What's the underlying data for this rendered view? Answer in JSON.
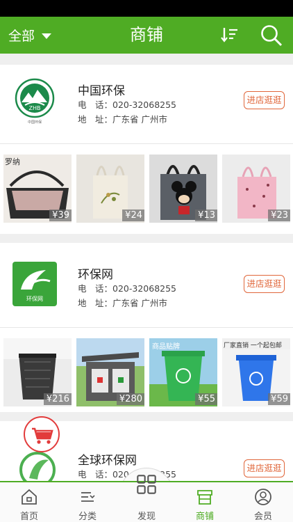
{
  "header": {
    "filter_label": "全部",
    "title": "商铺"
  },
  "colors": {
    "brand": "#4fac24",
    "accent": "#e0663a"
  },
  "shops": [
    {
      "name": "中国环保",
      "phone_label": "电　话：",
      "phone": "020-32068255",
      "address_label": "地　址：",
      "address": "广东省 广州市",
      "logo_caption": "中国环保",
      "logo_text": "ZHB",
      "visit_label": "进店逛逛",
      "products": [
        {
          "price": "¥39",
          "icon": "handbag-image"
        },
        {
          "price": "¥24",
          "icon": "canvas-tote-image"
        },
        {
          "price": "¥13",
          "icon": "mickey-tote-image"
        },
        {
          "price": "¥23",
          "icon": "pink-tote-image"
        }
      ],
      "product_overlay_text": "罗纳"
    },
    {
      "name": "环保网",
      "phone_label": "电　话：",
      "phone": "020-32068255",
      "address_label": "地　址：",
      "address": "广东省 广州市",
      "logo_text": "环保网",
      "visit_label": "进店逛逛",
      "products": [
        {
          "price": "¥216",
          "icon": "rattan-bin-image"
        },
        {
          "price": "¥280",
          "icon": "outdoor-bin-image"
        },
        {
          "price": "¥55",
          "icon": "green-wheelie-bin-image"
        },
        {
          "price": "¥59",
          "icon": "blue-wheelie-bin-image"
        }
      ],
      "product_overlay_texts": [
        "商品贴牌",
        "厂家直销 一个起包邮"
      ]
    },
    {
      "name": "全球环保网",
      "phone_label": "电　话：",
      "phone": "020-32068255",
      "visit_label": "进店逛逛"
    }
  ],
  "tabbar": {
    "items": [
      {
        "label": "首页",
        "icon": "home-icon"
      },
      {
        "label": "分类",
        "icon": "category-icon"
      },
      {
        "label": "发现",
        "icon": "discover-grid-icon"
      },
      {
        "label": "商铺",
        "icon": "shop-icon"
      },
      {
        "label": "会员",
        "icon": "member-icon"
      }
    ],
    "active": "商铺"
  }
}
